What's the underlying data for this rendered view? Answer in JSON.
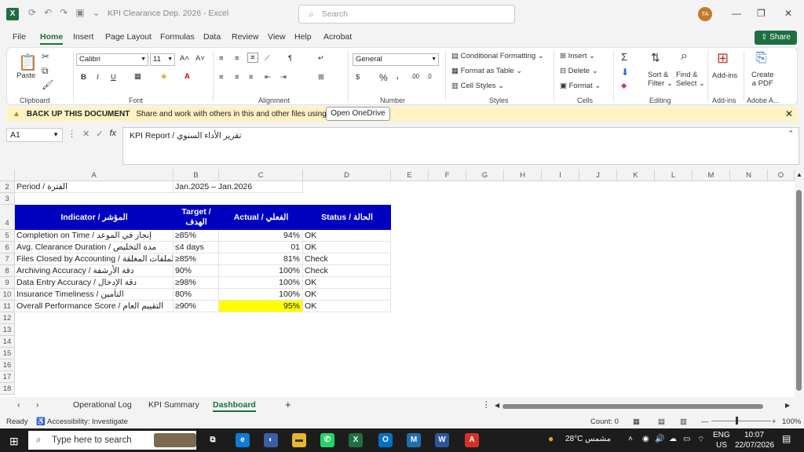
{
  "window": {
    "title": "KPI Clearance Dep. 2026  -  Excel",
    "search_placeholder": "Search",
    "user_initials": "TA",
    "share_label": "Share"
  },
  "menu": [
    "File",
    "Home",
    "Insert",
    "Page Layout",
    "Formulas",
    "Data",
    "Review",
    "View",
    "Help",
    "Acrobat"
  ],
  "ribbon": {
    "clipboard": {
      "label": "Clipboard",
      "paste": "Paste"
    },
    "font": {
      "label": "Font",
      "name": "Calibri",
      "size": "11"
    },
    "alignment": {
      "label": "Alignment"
    },
    "number": {
      "label": "Number",
      "format": "General"
    },
    "styles": {
      "label": "Styles",
      "conditional": "Conditional Formatting",
      "table": "Format as Table",
      "cell_styles": "Cell Styles"
    },
    "cells": {
      "label": "Cells",
      "insert": "Insert",
      "delete": "Delete",
      "format": "Format"
    },
    "editing": {
      "label": "Editing",
      "sort": "Sort &",
      "filter": "Filter",
      "find": "Find &",
      "select": "Select"
    },
    "addins": {
      "label": "Add-ins",
      "btn": "Add-ins"
    },
    "adobe": {
      "label": "Adobe A...",
      "create": "Create",
      "pdf": "a PDF"
    }
  },
  "message_bar": {
    "title": "BACK UP THIS DOCUMENT",
    "text": "Share and work with others in this and other files using OneDrive.",
    "button": "Open OneDrive"
  },
  "formula_bar": {
    "cell_ref": "A1",
    "fx": "fx",
    "content": "KPI Report / تقرير الأداء السنوي"
  },
  "columns": [
    "A",
    "B",
    "C",
    "D",
    "E",
    "F",
    "G",
    "H",
    "I",
    "J",
    "K",
    "L",
    "M",
    "N",
    "O"
  ],
  "rows": [
    "2",
    "3",
    "4",
    "5",
    "6",
    "7",
    "8",
    "9",
    "10",
    "11",
    "12",
    "13",
    "14",
    "15",
    "16",
    "17",
    "18"
  ],
  "sheet": {
    "period_label": "Period / الفترة",
    "period_value": "Jan.2025 – Jan.2026",
    "headers": {
      "indicator": "Indicator / المؤشر",
      "target": "Target / الهدف",
      "actual": "Actual / الفعلي",
      "status": "Status / الحالة"
    },
    "rows": [
      {
        "indicator": "Completion on Time / إنجاز في الموعد",
        "target": "≥85%",
        "actual": "94%",
        "status": "OK"
      },
      {
        "indicator": "Avg. Clearance Duration / مدة التخليص",
        "target": "≤4 days",
        "actual": "01",
        "status": "OK"
      },
      {
        "indicator": "Files Closed by Accounting / الملفات المغلقة",
        "target": "≥85%",
        "actual": "81%",
        "status": "Check"
      },
      {
        "indicator": "Archiving Accuracy / دقة الأرشفة",
        "target": "90%",
        "actual": "100%",
        "status": "Check"
      },
      {
        "indicator": "Data Entry Accuracy / دقة الإدخال",
        "target": "≥98%",
        "actual": "100%",
        "status": "OK"
      },
      {
        "indicator": "Insurance Timeliness / التأمين",
        "target": "80%",
        "actual": "100%",
        "status": "OK"
      },
      {
        "indicator": "Overall Performance Score / التقييم العام",
        "target": "≥90%",
        "actual": "95%",
        "status": "OK"
      }
    ]
  },
  "tabs": [
    "Operational Log",
    "KPI Summary",
    "Dashboard"
  ],
  "status": {
    "ready": "Ready",
    "accessibility": "Accessibility: Investigate",
    "count": "Count: 0",
    "zoom": "100%"
  },
  "taskbar": {
    "search_placeholder": "Type here to search",
    "weather": "28°C  مشمس",
    "lang": "ENG",
    "region": "US",
    "time": "10:07",
    "date": "22/07/2026"
  },
  "colors": {
    "excel_green": "#1d6f42",
    "header_blue": "#0000c0",
    "highlight": "#ffff00"
  }
}
